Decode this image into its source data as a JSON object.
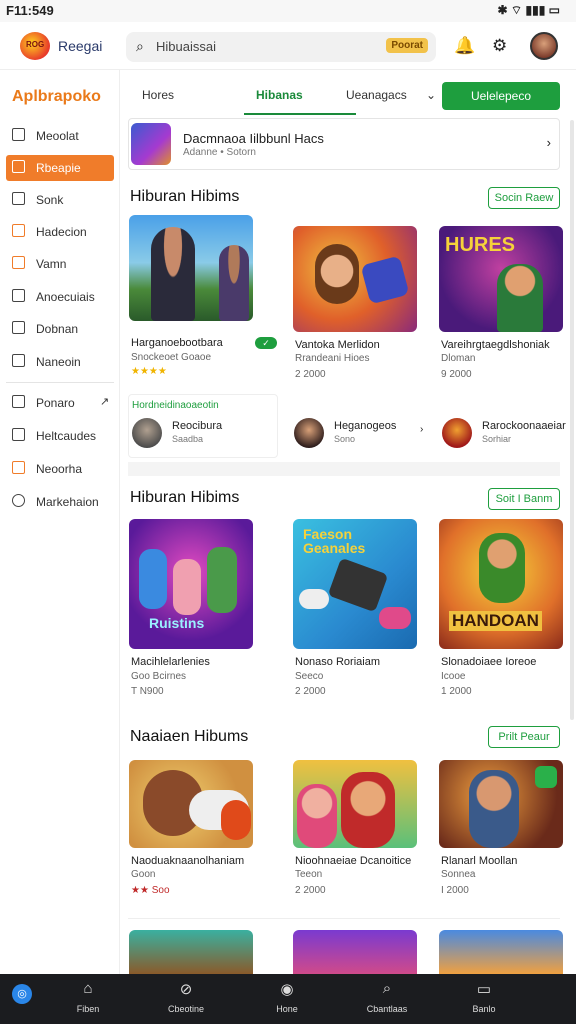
{
  "status": {
    "time": "F11:549",
    "icons": "✱ ⌔ ▮▮▮ ▭"
  },
  "topbar": {
    "app_name": "Reegai",
    "search_placeholder": "Hibuaissai",
    "search_badge": "Poorat",
    "logo_text": "ROG"
  },
  "sidebar": {
    "brand": "Aplbrapoko",
    "items": [
      {
        "label": "Meoolat",
        "icon": "square-icon"
      },
      {
        "label": "Rbeapie",
        "icon": "square-icon",
        "active": true
      },
      {
        "label": "Sonk",
        "icon": "box-icon"
      },
      {
        "label": "Hadecion",
        "icon": "grid-icon"
      },
      {
        "label": "Vamn",
        "icon": "check-icon"
      },
      {
        "label": "Anoecuiais",
        "icon": "lock-icon"
      },
      {
        "label": "Dobnan",
        "icon": "chart-icon"
      },
      {
        "label": "Naneoin",
        "icon": "chat-icon"
      },
      {
        "label": "Ponaro",
        "icon": "tag-icon",
        "extra": "↗"
      },
      {
        "label": "Heltcaudes",
        "icon": "list-icon"
      },
      {
        "label": "Neoorha",
        "icon": "doc-icon"
      },
      {
        "label": "Markehaion",
        "icon": "pin-icon"
      }
    ]
  },
  "tabs": [
    {
      "label": "Hores"
    },
    {
      "label": "Hibanas",
      "active": true
    },
    {
      "label": "Ueanagacs"
    }
  ],
  "tab_dropdown": "⌄",
  "cta_label": "Uelelepeco",
  "feature": {
    "title": "Dacmnaoa Iilbbunl Hacs",
    "subtitle": "Adanne • Sotorn",
    "arrow": "›"
  },
  "section1": {
    "title": "Hiburan Hibims",
    "see_all": "Socin Raew",
    "cards": [
      {
        "name1": "Harganoebootbara",
        "name2": "Snockeoet Goaoe",
        "meta": "★★★★",
        "tag": "✓"
      },
      {
        "name1": "Vantoka Merlidon",
        "name2": "Rrandeani Hioes",
        "meta": "2 2000"
      },
      {
        "name1": "Vareihrgtaegdlshoniak",
        "name2": "Dloman",
        "meta": "9 2000"
      }
    ],
    "list_header": "Hordneidinaoaeotin",
    "list": [
      {
        "title": "Reocibura",
        "sub": "Saadba"
      },
      {
        "title": "Heganogeos",
        "sub": "Sono"
      },
      {
        "title": "Rarockoonaaeiar",
        "sub": "Sorhiar"
      }
    ],
    "list_arrow": "›"
  },
  "section2": {
    "title": "Hiburan Hibims",
    "see_all": "Soit I Banm",
    "cards": [
      {
        "name1": "Macihlelarlenies",
        "name2": "Goo Bcirnes",
        "meta": "T N900"
      },
      {
        "name1": "Nonaso Roriaiam",
        "name2": "Seeco",
        "meta": "2 2000"
      },
      {
        "name1": "Slonadoiaee Ioreoe",
        "name2": "Icooe",
        "meta": "1 2000"
      }
    ],
    "art": {
      "card1": "Ruistins",
      "card2": "Faeson Geanales",
      "card3": "HANDOAN"
    }
  },
  "section3": {
    "title": "Naaiaen Hibums",
    "see_all": "Prilt Peaur",
    "cards": [
      {
        "name1": "Naoduaknaanolhaniam",
        "name2": "Goon",
        "meta": "★★ Soo"
      },
      {
        "name1": "Nioohnaeiae Dcanoitice",
        "name2": "Teeon",
        "meta": "2 2000"
      },
      {
        "name1": "Rlanarl Moollan",
        "name2": "Sonnea",
        "meta": "I 2000"
      }
    ]
  },
  "bottom_nav": [
    {
      "label": "Fiben",
      "icon": "home-icon"
    },
    {
      "label": "Cbeotine",
      "icon": "game-icon"
    },
    {
      "label": "Hone",
      "icon": "circle-icon"
    },
    {
      "label": "Cbantlaas",
      "icon": "search-icon"
    },
    {
      "label": "Banlo",
      "icon": "tablet-icon"
    }
  ],
  "colors": {
    "accent_green": "#1e9e3e",
    "accent_orange": "#f07c2a",
    "nav_bg": "#1b1c1f"
  }
}
